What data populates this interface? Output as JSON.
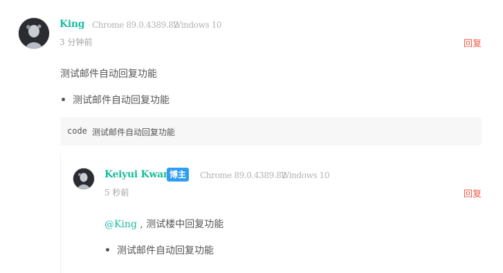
{
  "comment": {
    "author": "King",
    "browser": "Chrome 89.0.4389.82",
    "os": "Windows 10",
    "time": "3 分钟前",
    "reply_label": "回复",
    "paragraph": "测试邮件自动回复功能",
    "list_item": "测试邮件自动回复功能",
    "code_keyword": "code",
    "code_text": "测试邮件自动回复功能"
  },
  "reply_comment": {
    "author": "Keiyui Kwan",
    "badge": "博主",
    "browser": "Chrome 89.0.4389.82",
    "os": "Windows 10",
    "time": "5 秒前",
    "reply_label": "回复",
    "mention": "@King",
    "mention_suffix": " , 测试楼中回复功能",
    "list_item": "测试邮件自动回复功能"
  },
  "colors": {
    "accent": "#1abc9c",
    "reply": "#ef5a45",
    "badge": "#2e9cf0"
  }
}
